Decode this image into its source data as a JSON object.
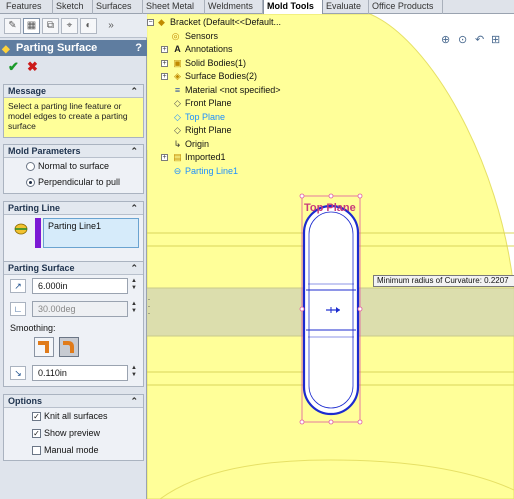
{
  "tabs": [
    {
      "label": "Features",
      "active": false
    },
    {
      "label": "Sketch",
      "active": false
    },
    {
      "label": "Surfaces",
      "active": false
    },
    {
      "label": "Sheet Metal",
      "active": false
    },
    {
      "label": "Weldments",
      "active": false
    },
    {
      "label": "Mold Tools",
      "active": true
    },
    {
      "label": "Evaluate",
      "active": false
    },
    {
      "label": "Office Products",
      "active": false
    }
  ],
  "property_manager": {
    "icon_tabs": [
      "feature-manager-icon",
      "property-manager-icon",
      "configuration-manager-icon",
      "dimxpert-icon",
      "display-manager-icon"
    ],
    "title": "Parting Surface",
    "help": "?",
    "message": {
      "header": "Message",
      "text": "Select a parting line feature or model edges to create a parting surface"
    },
    "mold_parameters": {
      "header": "Mold Parameters",
      "options": [
        {
          "label": "Normal to surface",
          "selected": false
        },
        {
          "label": "Perpendicular to pull",
          "selected": true
        }
      ]
    },
    "parting_line": {
      "header": "Parting Line",
      "selection": "Parting Line1",
      "selection_color": "#7b19d4"
    },
    "parting_surface": {
      "header": "Parting Surface",
      "distance": "6.000in",
      "angle": "30.00deg",
      "smoothing_label": "Smoothing:",
      "smoothing_distance": "0.110in"
    },
    "options": {
      "header": "Options",
      "items": [
        {
          "label": "Knit all surfaces",
          "checked": true
        },
        {
          "label": "Show preview",
          "checked": true
        },
        {
          "label": "Manual mode",
          "checked": false
        }
      ]
    }
  },
  "feature_tree": {
    "root": "Bracket  (Default<<Default...",
    "items": [
      {
        "label": "Sensors",
        "icon": "sensors-icon",
        "expandable": false,
        "highlight": false
      },
      {
        "label": "Annotations",
        "icon": "annotations-icon",
        "expandable": true,
        "highlight": false
      },
      {
        "label": "Solid Bodies(1)",
        "icon": "solid-bodies-icon",
        "expandable": true,
        "highlight": false
      },
      {
        "label": "Surface Bodies(2)",
        "icon": "surface-bodies-icon",
        "expandable": true,
        "highlight": false
      },
      {
        "label": "Material <not specified>",
        "icon": "material-icon",
        "expandable": false,
        "highlight": false
      },
      {
        "label": "Front Plane",
        "icon": "plane-icon",
        "expandable": false,
        "highlight": false
      },
      {
        "label": "Top Plane",
        "icon": "plane-icon",
        "expandable": false,
        "highlight": true
      },
      {
        "label": "Right Plane",
        "icon": "plane-icon",
        "expandable": false,
        "highlight": false
      },
      {
        "label": "Origin",
        "icon": "origin-icon",
        "expandable": false,
        "highlight": false
      },
      {
        "label": "Imported1",
        "icon": "imported-icon",
        "expandable": true,
        "highlight": false
      },
      {
        "label": "Parting Line1",
        "icon": "parting-line-icon",
        "expandable": false,
        "highlight": true
      }
    ]
  },
  "viewport": {
    "plane_label": "Top Plane",
    "tooltip": "Minimum radius of Curvature: 0.2207",
    "colors": {
      "surface_fill": "#ffff99",
      "surface_edge": "#e6e066",
      "part_outline": "#1c2bcf",
      "plane_label": "#c83a7a",
      "handles": "#e05aa0"
    }
  }
}
